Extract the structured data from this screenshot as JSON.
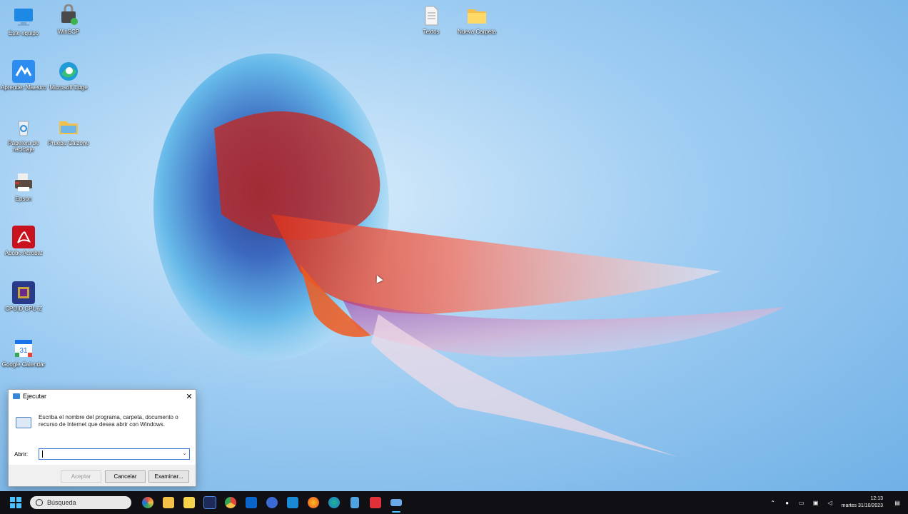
{
  "desktop": {
    "icons": [
      {
        "label": "Este equipo",
        "icon": "computer-icon",
        "color": "#1e88e5"
      },
      {
        "label": "WinSCP",
        "icon": "winscp-icon",
        "color": "#4a4a4a"
      },
      {
        "label": "Aprender Maestro",
        "icon": "app-icon",
        "color": "#2d8cf0"
      },
      {
        "label": "Microsoft Edge",
        "icon": "edge-icon",
        "color": "#1f9bd8"
      },
      {
        "label": "Papelera de reciclaje",
        "icon": "recycle-bin-icon",
        "color": "#e8eef4"
      },
      {
        "label": "Prueba Calzone",
        "icon": "folder-icon",
        "color": "#f3c04a"
      },
      {
        "label": "Epson",
        "icon": "printer-icon",
        "color": "#5a4a40"
      },
      {
        "label": "Adobe Acrobat",
        "icon": "acrobat-icon",
        "color": "#c8131e"
      },
      {
        "label": "CPUID CPU-Z",
        "icon": "cpuz-icon",
        "color": "#2a3a8a"
      },
      {
        "label": "Google Calendar",
        "icon": "calendar-icon",
        "color": "#1a73e8"
      },
      {
        "label": "Textos",
        "icon": "text-file-icon",
        "color": "#f5f5f5"
      },
      {
        "label": "Nueva Carpeta",
        "icon": "folder-icon",
        "color": "#f3c04a"
      }
    ]
  },
  "run_dialog": {
    "title": "Ejecutar",
    "description": "Escriba el nombre del programa, carpeta, documento o recurso de Internet que desea abrir con Windows.",
    "open_label": "Abrir:",
    "open_value": "",
    "accept_label": "Aceptar",
    "cancel_label": "Cancelar",
    "browse_label": "Examinar..."
  },
  "taskbar": {
    "search_placeholder": "Búsqueda",
    "apps": [
      {
        "icon": "colorful-app-icon",
        "color": "#e24a3b"
      },
      {
        "icon": "file-explorer-icon",
        "color": "#f3c04a"
      },
      {
        "icon": "store-icon",
        "color": "#f5d34a"
      },
      {
        "icon": "photoshop-icon",
        "color": "#1e2a5a"
      },
      {
        "icon": "chrome-icon",
        "color": "#e8453c"
      },
      {
        "icon": "outlook-icon",
        "color": "#0a64c9"
      },
      {
        "icon": "app-icon",
        "color": "#3b6ad6"
      },
      {
        "icon": "vscode-icon",
        "color": "#1a8ad4"
      },
      {
        "icon": "firefox-icon",
        "color": "#f57a1e"
      },
      {
        "icon": "edge-icon",
        "color": "#1fb58a"
      },
      {
        "icon": "notepad-icon",
        "color": "#4fa3e0"
      },
      {
        "icon": "app-icon",
        "color": "#e0303a"
      },
      {
        "icon": "run-icon",
        "color": "#6aa8e8",
        "active": true
      }
    ],
    "clock_time": "12:13",
    "clock_date": "martes 31/10/2023"
  }
}
